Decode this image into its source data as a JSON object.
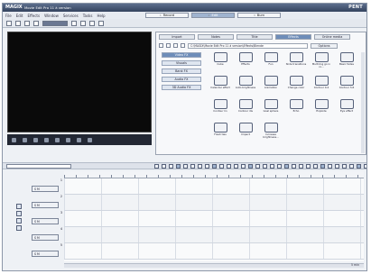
{
  "titlebar": {
    "brand": "MAGIX",
    "title": "Movie Edit Pro 11 à version",
    "brand_right": "PENT"
  },
  "menu": [
    "File",
    "Edit",
    "Effects",
    "Window",
    "Services",
    "Tasks",
    "Help"
  ],
  "modes": [
    {
      "num": "1",
      "label": "Record",
      "active": false
    },
    {
      "num": "2",
      "label": "Edit",
      "active": true
    },
    {
      "num": "3",
      "label": "Burn",
      "active": false
    }
  ],
  "media_pool": {
    "tabs": [
      {
        "label": "Import",
        "active": false
      },
      {
        "label": "Notes",
        "active": false
      },
      {
        "label": "Title",
        "active": false
      },
      {
        "label": "Effects",
        "active": true
      },
      {
        "label": "Online media",
        "active": false
      }
    ],
    "path": "C:\\MAGIX\\Movie Edit Pro 11 à version\\Effects\\Blende",
    "options_label": "Options",
    "categories": [
      {
        "label": "Video FX",
        "active": true
      },
      {
        "label": "Visuals",
        "active": false
      },
      {
        "label": "Bank FX",
        "active": false
      },
      {
        "label": "Audio FX",
        "active": false
      },
      {
        "label": "3D Audio FX",
        "active": false
      }
    ],
    "effects": [
      "Cube",
      "Effects",
      "Fun",
      "Slide transitions",
      "Multiring go in ro...",
      "Basic fades",
      "Calendar effect",
      "Auto brightness",
      "Animation",
      "Change color",
      "Contour 0-2",
      "Contour 3-6",
      "Contour lin",
      "Contour dis",
      "Goal sphere",
      "Echo",
      "Explode",
      "Eye effect",
      "Fresh ties",
      "Impact",
      "Increase brightness..."
    ]
  },
  "timeline": {
    "tracks": [
      {
        "number": "1",
        "label": "S M"
      },
      {
        "number": "2",
        "label": "S M"
      },
      {
        "number": "3",
        "label": "S M"
      },
      {
        "number": "4",
        "label": "S M"
      },
      {
        "number": "5",
        "label": "S M"
      }
    ],
    "zoom_label": "5 min"
  }
}
